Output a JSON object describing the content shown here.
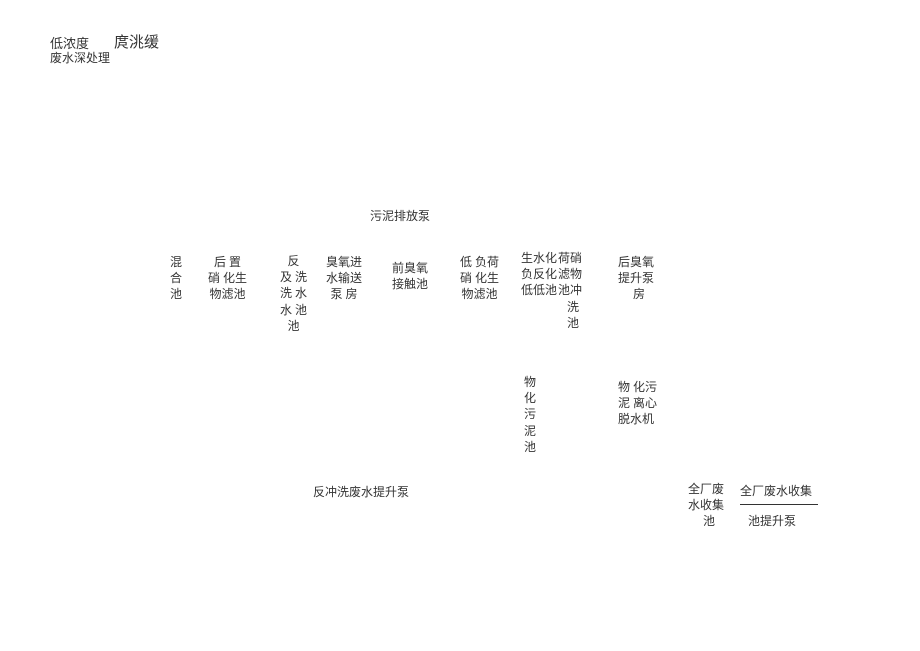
{
  "header": {
    "line1": "低浓度",
    "line2": "废水深处理",
    "line3": "庹洮缓"
  },
  "sludge_pump": "污泥排放泵",
  "process_row": {
    "mix_tank": "混\n合\n池",
    "post_denit": "后 置\n硝 化生\n物滤池",
    "reverse_wash": "反\n及 洗\n洗 水\n水 池\n池",
    "ozone_inlet": "臭氧进\n水输送\n泵 房",
    "pre_ozone": "前臭氧\n接触池",
    "low_load": "低 负荷\n硝 化生\n物滤池",
    "anoxic": "生水化\n负反化\n低低池",
    "nitrate_filter": "荷硝\n滤物\n池冲\n  洗\n  池",
    "post_ozone_lift": "后臭氧\n提升泵\n  房"
  },
  "mid": {
    "phys_chem_sludge": "物\n化\n污\n泥\n池",
    "phys_chem_centrifuge": "物 化污\n泥 离心\n脱水机"
  },
  "backwash_lift": "反冲洗废水提升泵",
  "collection": {
    "tank": "全厂废\n水收集\n  池",
    "title": "全厂废水收集",
    "sub": "池提升泵"
  }
}
